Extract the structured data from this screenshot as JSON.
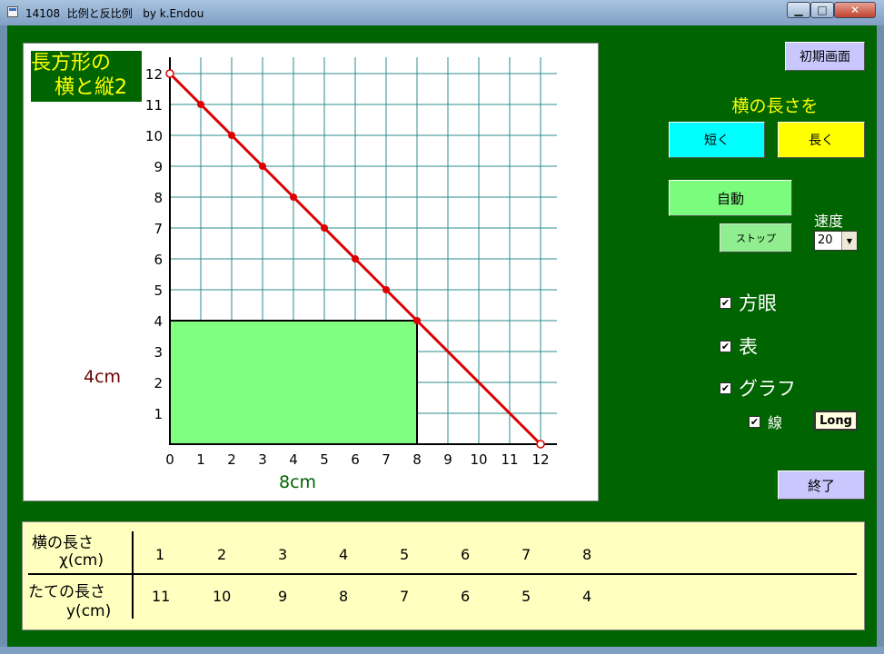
{
  "window": {
    "title": "14108  比例と反比例   by k.Endou",
    "minimize_glyph": "▁",
    "maximize_glyph": "□",
    "close_glyph": "✕"
  },
  "chart_title": {
    "line1": "長方形の",
    "line2": "横と縦2"
  },
  "chart_data": {
    "type": "line",
    "x_ticks": [
      "0",
      "1",
      "2",
      "3",
      "4",
      "5",
      "6",
      "7",
      "8",
      "9",
      "10",
      "11",
      "12"
    ],
    "y_ticks": [
      "1",
      "2",
      "3",
      "4",
      "5",
      "6",
      "7",
      "8",
      "9",
      "10",
      "11",
      "12"
    ],
    "xlim": [
      0,
      12
    ],
    "ylim": [
      0,
      12
    ],
    "grid": true,
    "series": [
      {
        "x": [
          0,
          1,
          2,
          3,
          4,
          5,
          6,
          7,
          8,
          12
        ],
        "y": [
          12,
          11,
          10,
          9,
          8,
          7,
          6,
          5,
          4,
          0
        ],
        "color": "#dd0000"
      }
    ],
    "endpoints": [
      [
        0,
        12
      ],
      [
        12,
        0
      ]
    ],
    "rectangle": {
      "width": 8,
      "height": 4,
      "fill": "#80ff80"
    },
    "width_label": "8cm",
    "height_label": "4cm"
  },
  "controls": {
    "reset_label": "初期画面",
    "prompt_label": "横の長さを",
    "short_label": "短く",
    "long_label": "長く",
    "auto_label": "自動",
    "stop_label": "ストップ",
    "speed_label": "速度",
    "speed_value": "20",
    "grid_label": "方眼",
    "table_label": "表",
    "graph_label": "グラフ",
    "line_label": "線",
    "long_mode_label": "Long",
    "exit_label": "終了",
    "check_glyph": "✔"
  },
  "table": {
    "row1_header_line1": "横の長さ",
    "row1_header_line2": "χ(cm)",
    "row2_header_line1": "たての長さ",
    "row2_header_line2": "y(cm)",
    "x_values": [
      "1",
      "2",
      "3",
      "4",
      "5",
      "6",
      "7",
      "8"
    ],
    "y_values": [
      "11",
      "10",
      "9",
      "8",
      "7",
      "6",
      "5",
      "4"
    ]
  },
  "colors": {
    "background": "#006400",
    "accent_yellow": "#ffff00",
    "line": "#dd0000",
    "grid": "#2e8b8b"
  }
}
